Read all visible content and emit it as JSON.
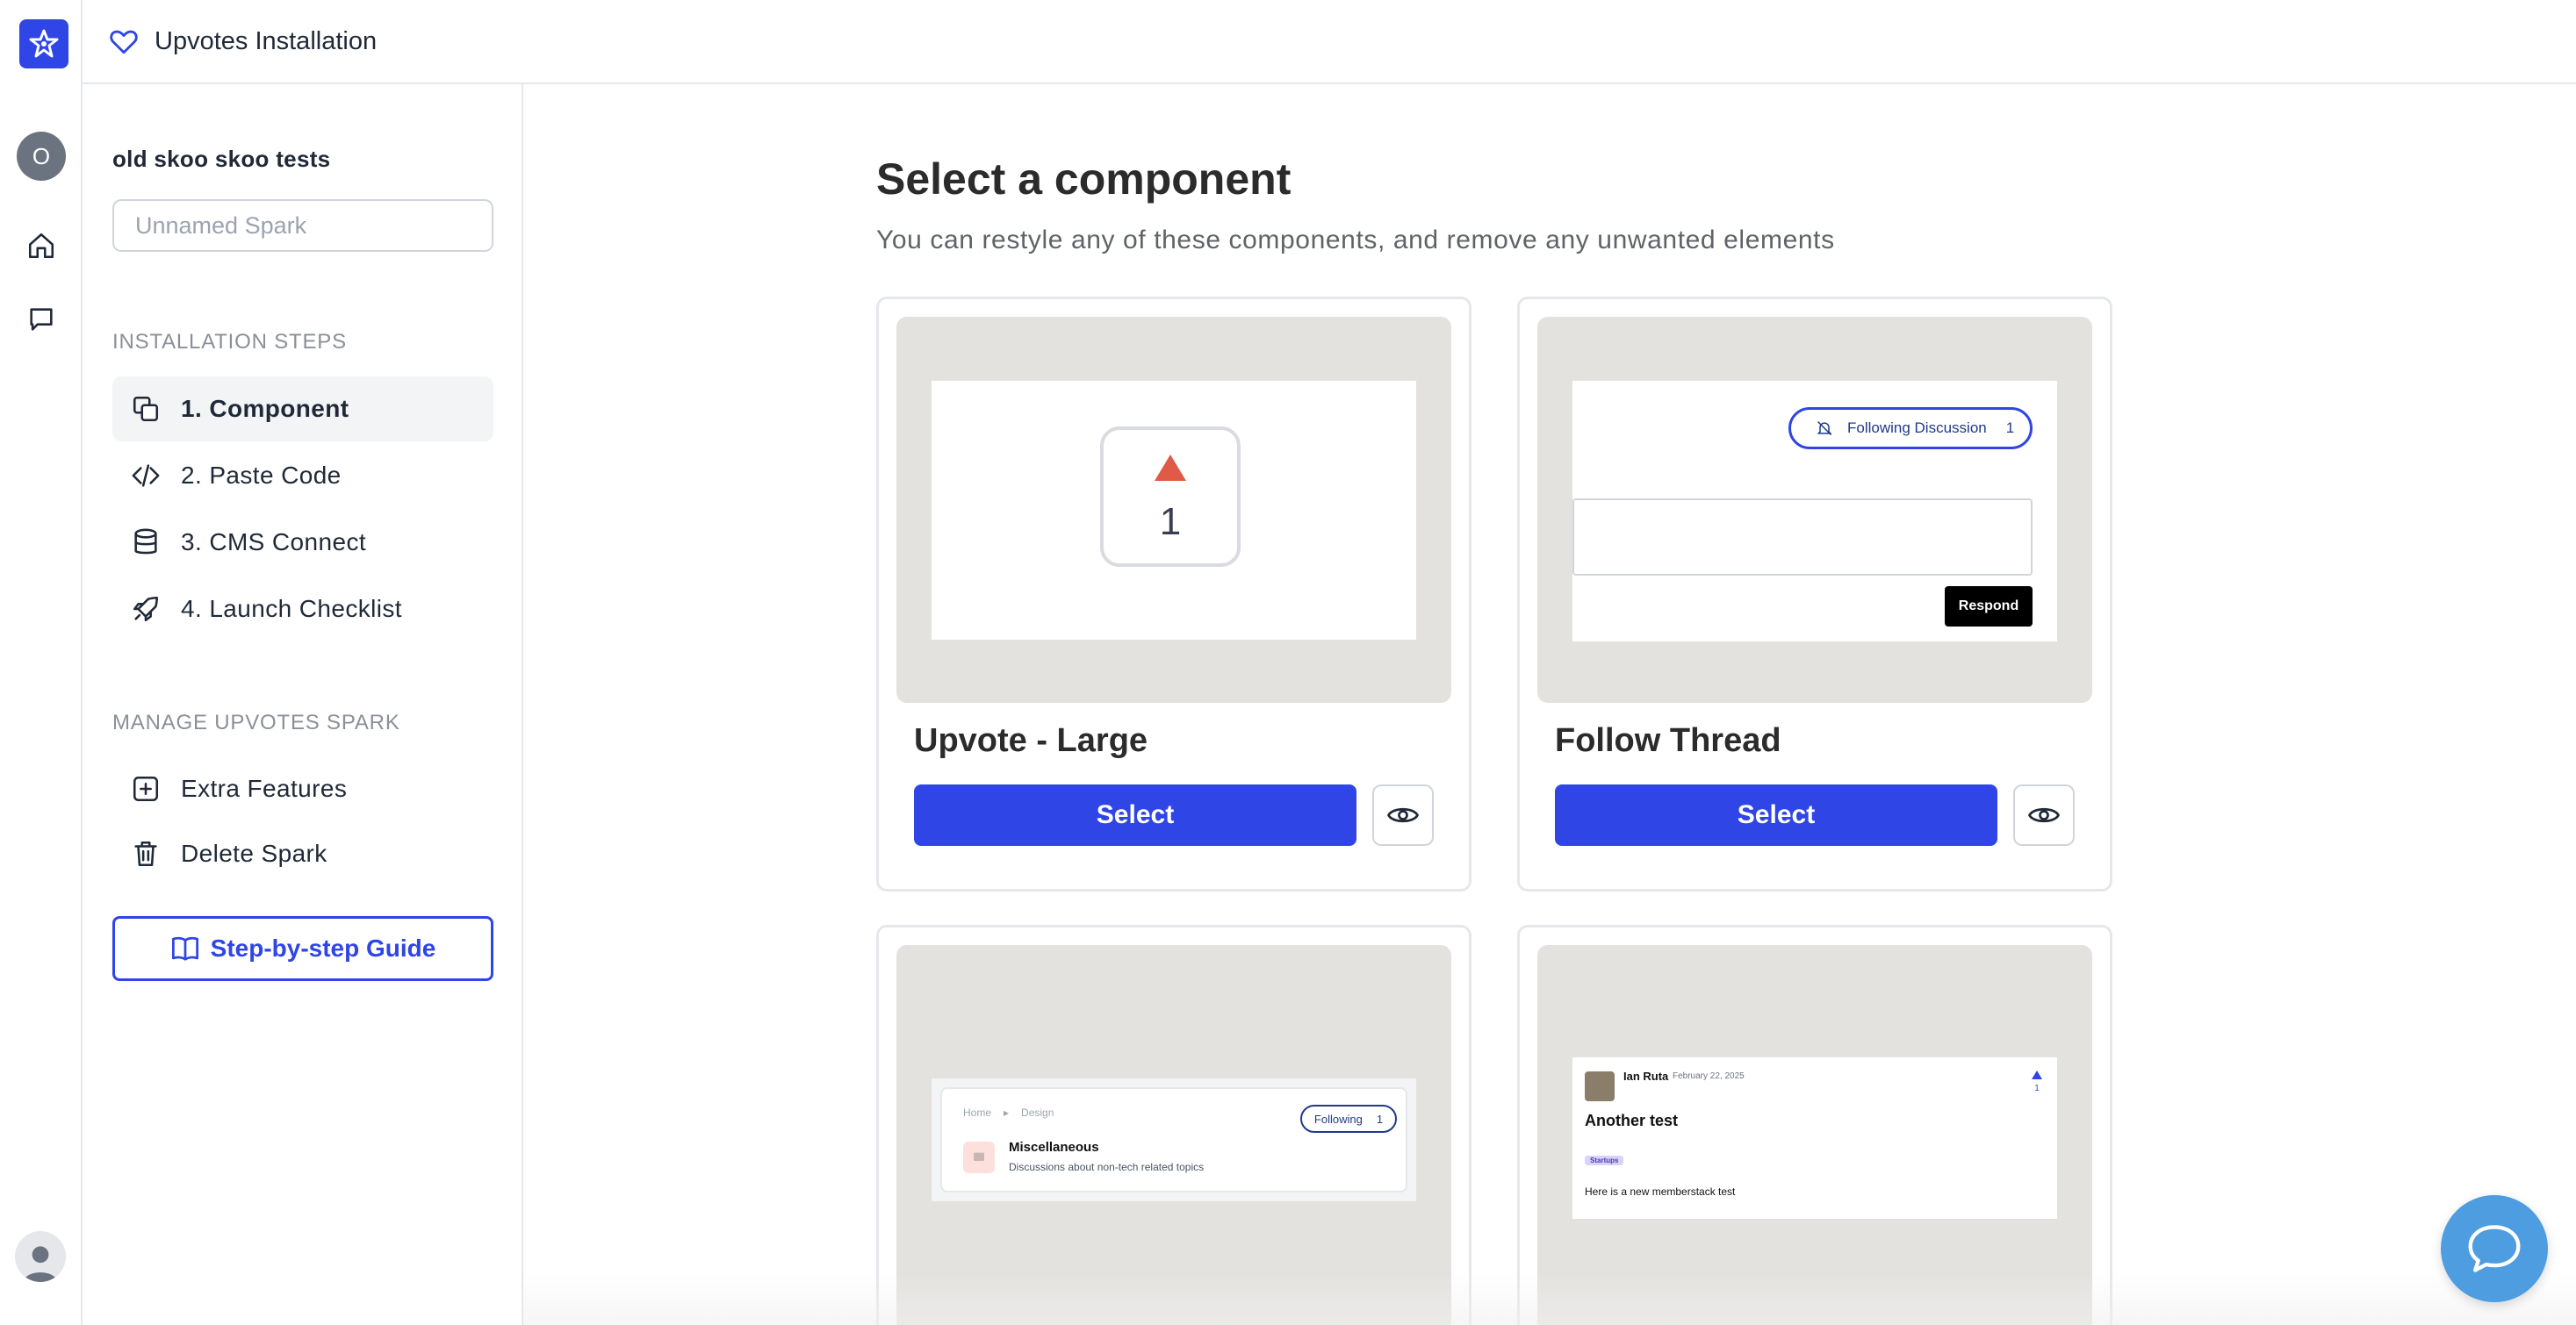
{
  "colors": {
    "accent": "#2f45e6",
    "preview_bg": "#e3e2df",
    "upvote_red": "#e05a47",
    "chat_blue": "#4d9de0"
  },
  "rail": {
    "avatar_initial": "O",
    "icons": [
      "home-icon",
      "chat-icon",
      "user-icon"
    ]
  },
  "topbar": {
    "title": "Upvotes Installation",
    "icon": "heart-icon"
  },
  "sidebar": {
    "project_name": "old skoo skoo tests",
    "spark_name_placeholder": "Unnamed Spark",
    "install_section_label": "INSTALLATION STEPS",
    "install_steps": [
      {
        "label": "1. Component",
        "icon": "copy-icon",
        "active": true
      },
      {
        "label": "2. Paste Code",
        "icon": "code-icon",
        "active": false
      },
      {
        "label": "3. CMS Connect",
        "icon": "database-icon",
        "active": false
      },
      {
        "label": "4. Launch Checklist",
        "icon": "rocket-icon",
        "active": false
      }
    ],
    "manage_section_label": "MANAGE UPVOTES SPARK",
    "manage_items": [
      {
        "label": "Extra Features",
        "icon": "plus-square-icon"
      },
      {
        "label": "Delete Spark",
        "icon": "trash-icon"
      }
    ],
    "guide_button": "Step-by-step Guide"
  },
  "main": {
    "title": "Select a component",
    "subtitle": "You can restyle any of these components, and remove any unwanted elements",
    "select_label": "Select",
    "cards": [
      {
        "name": "Upvote - Large",
        "preview": {
          "count": "1"
        }
      },
      {
        "name": "Follow Thread",
        "preview": {
          "follow_label": "Following Discussion",
          "follow_count": "1",
          "respond_label": "Respond"
        }
      },
      {
        "name": "",
        "preview": {
          "crumb_home": "Home",
          "crumb_design": "Design",
          "follow_label": "Following",
          "follow_count": "1",
          "topic_title": "Miscellaneous",
          "topic_desc": "Discussions about non-tech related topics"
        }
      },
      {
        "name": "",
        "preview": {
          "author": "Ian Ruta",
          "date": "February 22, 2025",
          "vote_count": "1",
          "post_title": "Another test",
          "tag": "Startups",
          "post_body": "Here is a new memberstack test"
        }
      }
    ]
  }
}
